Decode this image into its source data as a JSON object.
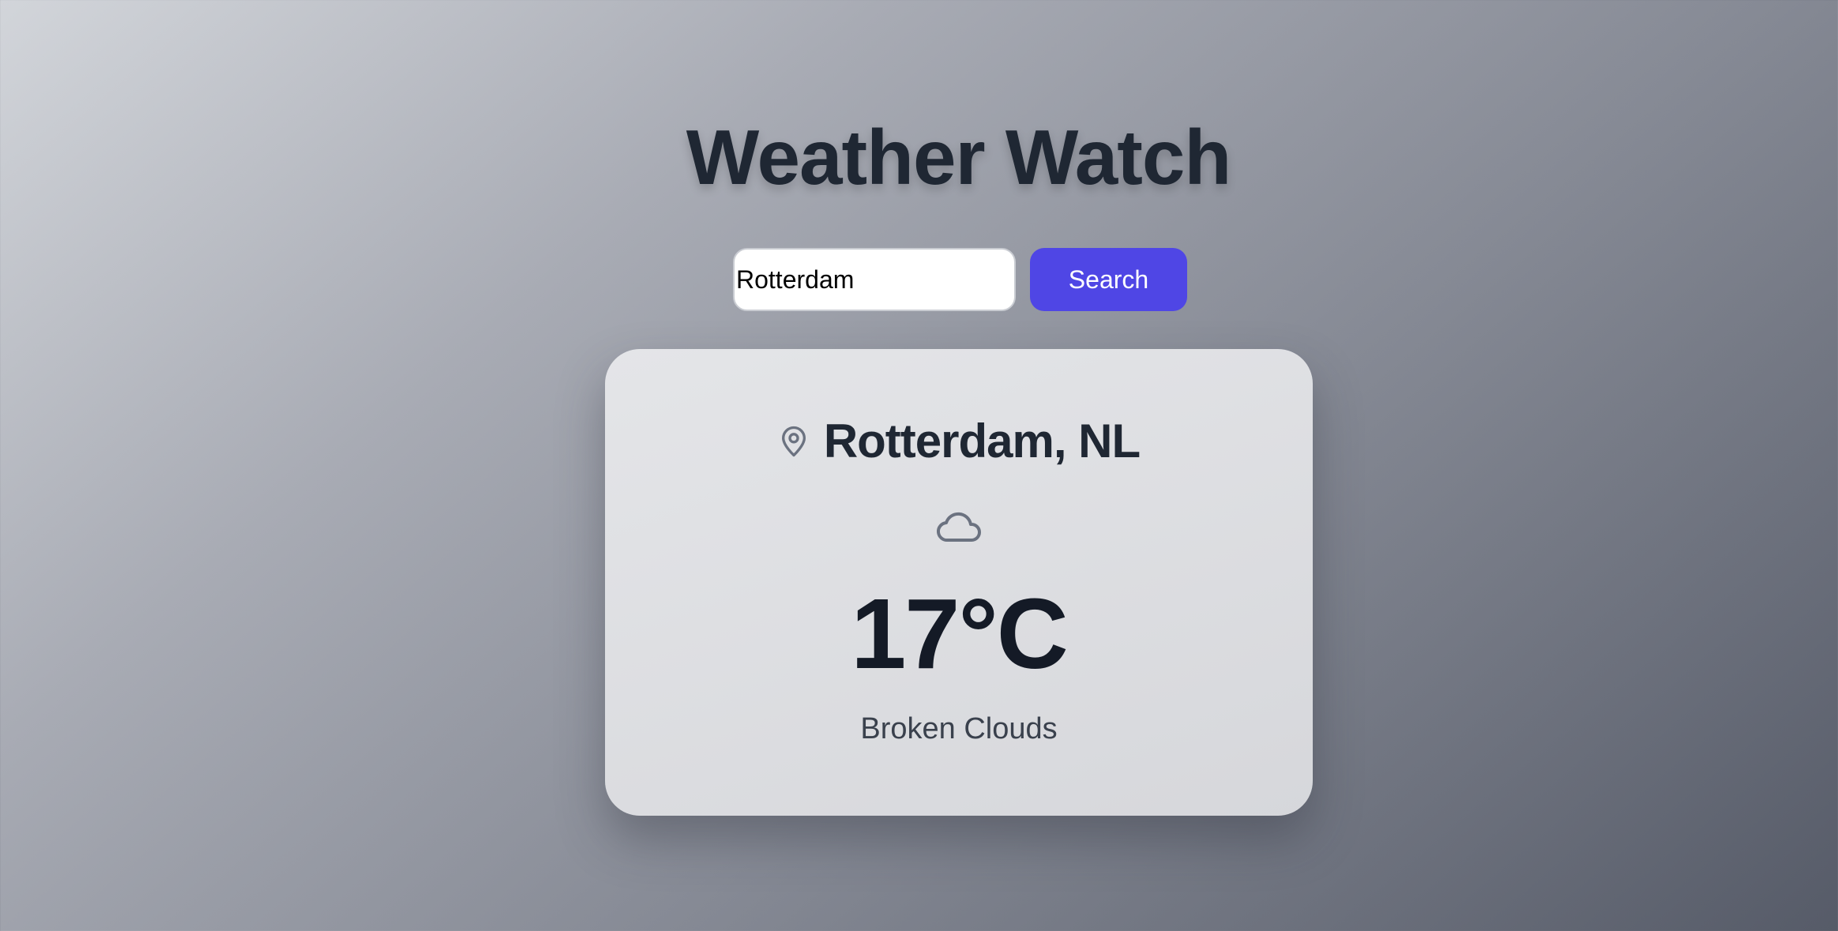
{
  "app": {
    "title": "Weather Watch"
  },
  "search": {
    "value": "Rotterdam",
    "button_label": "Search"
  },
  "weather": {
    "location": "Rotterdam, NL",
    "location_icon": "map-pin-icon",
    "condition_icon": "cloud-icon",
    "temperature": "17°C",
    "description": "Broken Clouds"
  },
  "colors": {
    "accent": "#4f46e5",
    "title": "#1f2733",
    "icon": "#6b7280"
  }
}
